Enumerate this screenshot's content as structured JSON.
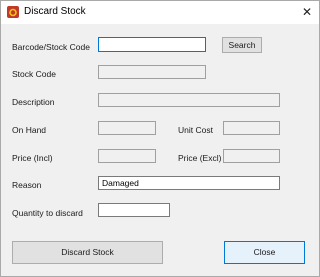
{
  "window": {
    "title": "Discard Stock",
    "close_glyph": "✕"
  },
  "form": {
    "barcode_label": "Barcode/Stock Code",
    "barcode_value": "",
    "search_label": "Search",
    "stock_code_label": "Stock Code",
    "stock_code_value": "",
    "description_label": "Description",
    "description_value": "",
    "on_hand_label": "On Hand",
    "on_hand_value": "",
    "unit_cost_label": "Unit Cost",
    "unit_cost_value": "",
    "price_incl_label": "Price (Incl)",
    "price_incl_value": "",
    "price_excl_label": "Price (Excl)",
    "price_excl_value": "",
    "reason_label": "Reason",
    "reason_value": "Damaged",
    "quantity_label": "Quantity to discard",
    "quantity_value": ""
  },
  "footer": {
    "discard_label": "Discard Stock",
    "close_label": "Close"
  },
  "icons": {
    "app": "app-logo-icon",
    "close": "close-icon"
  },
  "colors": {
    "accent": "#0078d7",
    "logo": "#c0392b"
  }
}
